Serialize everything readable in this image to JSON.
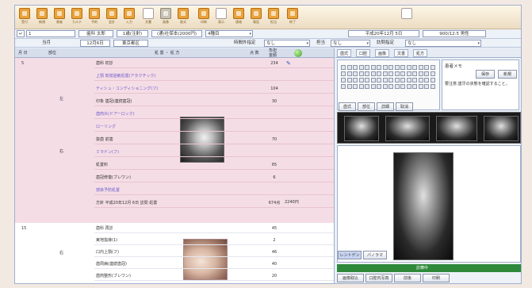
{
  "toolbar": {
    "buttons": [
      {
        "icon": "bell-icon",
        "caption": "受付"
      },
      {
        "icon": "document-icon",
        "caption": "新規"
      },
      {
        "icon": "patient-icon",
        "caption": "患者"
      },
      {
        "icon": "chart-icon",
        "caption": "カルテ"
      },
      {
        "icon": "calendar-icon",
        "caption": "予約"
      },
      {
        "icon": "book-icon",
        "caption": "会計"
      },
      {
        "icon": "card-icon",
        "caption": "入力"
      },
      {
        "icon": "paper-icon",
        "caption": "文書"
      },
      {
        "icon": "image-icon",
        "caption": "画像"
      },
      {
        "icon": "tooth-icon",
        "caption": "歯式"
      },
      {
        "icon": "print-icon",
        "caption": "印刷"
      },
      {
        "icon": "monitor-icon",
        "caption": "表示"
      },
      {
        "icon": "mail-icon",
        "caption": "連絡"
      },
      {
        "icon": "phone-icon",
        "caption": "電話"
      },
      {
        "icon": "person-icon",
        "caption": "担当"
      },
      {
        "icon": "help-icon",
        "caption": "終了"
      }
    ]
  },
  "patient_bar": {
    "patient_id": "1",
    "name": "歯科 太郎",
    "age": "1歳(注射)",
    "insurance": "(通)社保本(2000円)",
    "count_label": "4種目",
    "date": "平成20年12月 5日",
    "time": "900/12:5 男性"
  },
  "filter_bar": {
    "label_month": "当月",
    "month_value": "12月6日",
    "period_value": "東京都区",
    "time_label": "時間外指定",
    "time_value": "なし",
    "doctor_label": "担当",
    "doctor_value": "なし",
    "visit_label": "訪問指定",
    "visit_value": "なし"
  },
  "grid": {
    "columns": [
      "月 日",
      "部位",
      "処 置 ・ 処 方",
      "点 数",
      "負担 金額",
      ""
    ],
    "date_1": "5",
    "date_2": "15",
    "rows_pink": [
      {
        "text": "歯科 初診",
        "points": "234",
        "blue": false
      },
      {
        "text": "上顎 知覚過敏処置(アタクチック)",
        "points": "",
        "blue": true
      },
      {
        "text": "ティシュ・コンディショニング(フ)",
        "points": "104",
        "blue": true
      },
      {
        "text": "印象 歯冠(連続歯冠)",
        "points": "30",
        "blue": false
      },
      {
        "text": "歯肉炎(ドアーロック)",
        "points": "",
        "blue": true
      },
      {
        "text": "ローリング",
        "points": "",
        "blue": true
      },
      {
        "text": "抜歯 前歯",
        "points": "70",
        "blue": false
      },
      {
        "text": "ミラドン(フ)",
        "points": "",
        "blue": true
      },
      {
        "text": "処置料",
        "points": "65",
        "blue": false
      },
      {
        "text": "歯冠修復(ブレワン)",
        "points": "6",
        "blue": false
      },
      {
        "text": "感染予防処置",
        "points": "",
        "blue": true
      },
      {
        "text": "方針 平成20年12月 6日 訪問 処置",
        "points": "674点",
        "blue": false
      }
    ],
    "rows_white": [
      {
        "text": "歯科 再診",
        "points": "45"
      },
      {
        "text": "実地指導(1)",
        "points": "2"
      },
      {
        "text": "口内上顎(フ)",
        "points": "46"
      },
      {
        "text": "歯周病(連続歯冠)",
        "points": "40"
      },
      {
        "text": "歯肉整形(ブレワン)",
        "points": "20"
      }
    ],
    "total_label": "674点",
    "total_amount": "2240円"
  },
  "right_panel": {
    "tabs": [
      "歯式",
      "口腔",
      "画像",
      "文書",
      "処方"
    ],
    "memo_text": "要注意:歯牙の状態を確認すること。",
    "memo_title": "患者メモ",
    "btn_save": "保存",
    "btn_new": "新規",
    "btn_tooth": "歯式",
    "btn_area": "部位",
    "btn_detail": "詳細",
    "btn_clear": "取消",
    "green_label": "診療中",
    "bottom_tabs": [
      "画像取込",
      "口腔内写真",
      "前後",
      "印刷"
    ],
    "overlay_tab_a": "レントゲン",
    "overlay_tab_b": "パノラマ"
  }
}
